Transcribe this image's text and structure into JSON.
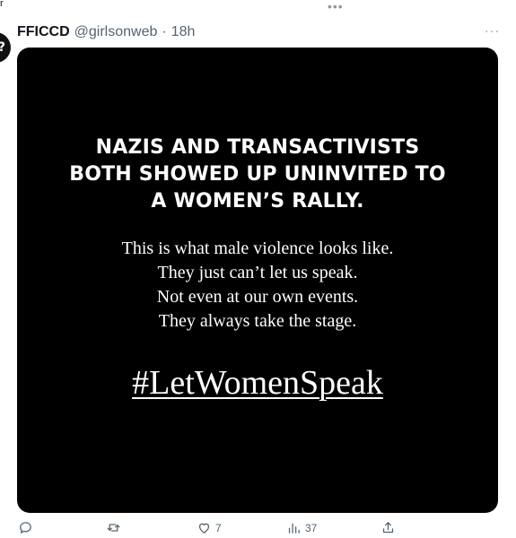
{
  "top_fragment": "r",
  "top_menu_glyph": "•••",
  "avatar": {
    "glyph": "?"
  },
  "tweet": {
    "author_name": "FFICCD",
    "author_handle": "@girlsonweb",
    "separator": "·",
    "timestamp": "18h",
    "more_glyph": "···"
  },
  "media": {
    "headline_lines": [
      "NAZIS AND TRANSACTIVISTS",
      "BOTH SHOWED UP UNINVITED TO",
      "A WOMEN’S RALLY."
    ],
    "body_lines": [
      "This is what male violence looks like.",
      "They just can’t let us speak.",
      "Not even at our own events.",
      "They always take the stage."
    ],
    "hashtag": "#LetWomenSpeak"
  },
  "actions": {
    "reply": {
      "icon": "reply-icon",
      "count": ""
    },
    "retweet": {
      "icon": "retweet-icon",
      "count": ""
    },
    "like": {
      "icon": "heart-icon",
      "count": "7"
    },
    "views": {
      "icon": "views-icon",
      "count": "37"
    },
    "share": {
      "icon": "share-icon",
      "count": ""
    }
  }
}
